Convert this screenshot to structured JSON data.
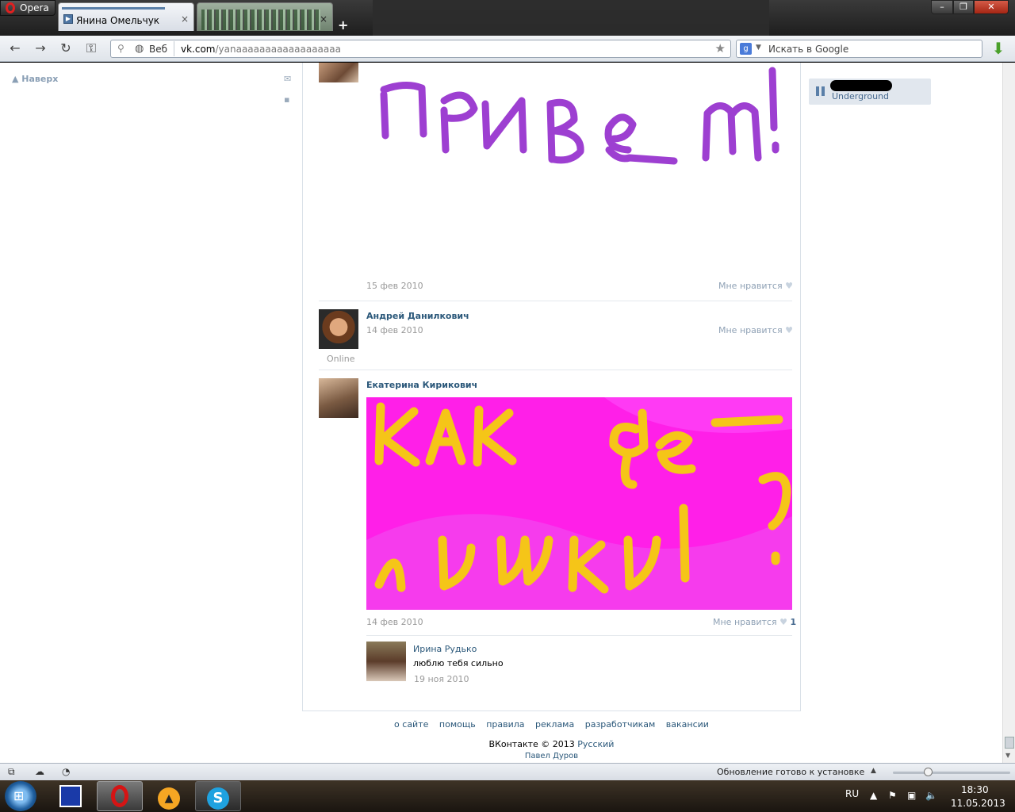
{
  "browser": {
    "menu_label": "Opera",
    "tabs": [
      {
        "title": "Янина Омельчук",
        "close": "×"
      },
      {
        "title": "",
        "close": "×"
      }
    ],
    "new_tab": "+",
    "window_buttons": {
      "minimize": "–",
      "maximize": "❐",
      "close": "✕"
    },
    "address": {
      "scheme_label": "Веб",
      "host": "vk.com",
      "path": "/yanaaaaaaaaaaaaaaaaaa"
    },
    "search_placeholder": "Искать в Google",
    "status": {
      "update_text": "Обновление готово к установке",
      "zoom_level": 0.3
    }
  },
  "sidebar": {
    "to_top": "Наверх"
  },
  "wall": {
    "posts": [
      {
        "date": "15 фев 2010",
        "like_label": "Мне нравится",
        "drawing_text": "привет!"
      },
      {
        "author": "Андрей Данилкович",
        "date": "14 фев 2010",
        "like_label": "Мне нравится",
        "status": "Online"
      },
      {
        "author": "Екатерина Кирикович",
        "date": "14 фев 2010",
        "like_label": "Мне нравится",
        "like_count": "1",
        "drawing_text": "как де-лишки?",
        "comment": {
          "author": "Ирина Рудько",
          "text": "люблю тебя сильно",
          "date": "19 ноя 2010"
        }
      }
    ]
  },
  "footer": {
    "links": [
      "о сайте",
      "помощь",
      "правила",
      "реклама",
      "разработчикам",
      "вакансии"
    ],
    "copyright": "ВКонтакте © 2013",
    "language": "Русский",
    "founder": "Павел Дуров"
  },
  "player": {
    "track": "Underground"
  },
  "taskbar": {
    "language": "RU",
    "time": "18:30",
    "date": "11.05.2013"
  },
  "colors": {
    "vk_link": "#2b587a",
    "purple_ink": "#9d3fd1",
    "pink_bg": "#ff1fe8",
    "yellow_ink": "#f5c518"
  },
  "icons": [
    "opera-logo-icon",
    "back-icon",
    "forward-icon",
    "reload-icon",
    "key-icon",
    "pin-icon",
    "globe-icon",
    "star-icon",
    "google-icon",
    "download-icon",
    "mail-icon",
    "chat-icon",
    "heart-icon",
    "pause-icon",
    "panel-icon",
    "cloud-icon",
    "speedometer-icon"
  ]
}
